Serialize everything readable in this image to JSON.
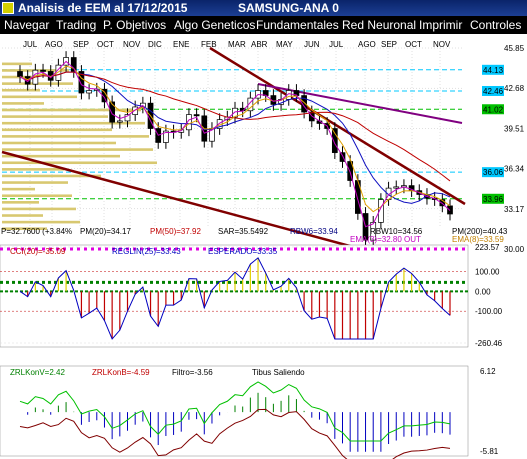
{
  "window": {
    "title": "Analisis de EEM al 17/12/2015",
    "symbol": "SAMSUNG-ANA 0"
  },
  "menu": [
    "Navegar",
    "Trading",
    "P. Objetivos",
    "Algo Geneticos",
    "Fundamentales",
    "Red Neuronal",
    "Imprimir",
    "Controles"
  ],
  "chart_data": {
    "type": "candlestick",
    "months": [
      "JUL",
      "AGO",
      "SEP",
      "OCT",
      "NOV",
      "DIC",
      "ENE",
      "FEB",
      "MAR",
      "ABR",
      "MAY",
      "JUN",
      "JUL",
      "AGO",
      "SEP",
      "OCT",
      "NOV"
    ],
    "price_ticks": [
      "45.85",
      "42.68",
      "39.51",
      "36.34",
      "33.17",
      "30.00"
    ],
    "price_range": [
      30.0,
      45.85
    ],
    "price_boxes": [
      {
        "value": "44.13",
        "color": "#00c8ff"
      },
      {
        "value": "42.46",
        "color": "#00c8ff"
      },
      {
        "value": "41.02",
        "color": "#00c000"
      },
      {
        "value": "36.06",
        "color": "#00c8ff"
      },
      {
        "value": "33.96",
        "color": "#00c000"
      }
    ],
    "info_top": "P=32.7600 (+3.84%",
    "info_labels": [
      "PM(20)=34.17",
      "PM(50)=37.92",
      "SAR=35.5492",
      "RBW6=33.94",
      "RBW10=34.56",
      "PM(200)=40.43"
    ],
    "info_ema3": "EMA(3)=32.80 OUT",
    "info_ema8": "EMA(8)=33.59",
    "osc1_labels": [
      "CCI(20)=-35.09",
      "REGLIN(25)=33.43",
      "ESPERADO=33.35"
    ],
    "osc1_ticks": [
      "223.57",
      "100.00",
      "0.00",
      "-100.00",
      "-260.46"
    ],
    "osc1_range": [
      -260.46,
      223.57
    ],
    "osc2_labels": [
      "ZRLKonV=2.42",
      "ZRLKonB=-4.59",
      "Filtro=-3.56",
      "Tibus Saliendo"
    ],
    "osc2_ticks": [
      "6.12",
      "-5.81"
    ],
    "osc2_range": [
      -5.81,
      6.12
    ],
    "close": [
      43.6,
      43.0,
      44.1,
      44.0,
      43.3,
      44.5,
      45.1,
      44.0,
      42.3,
      42.5,
      42.6,
      41.6,
      40.0,
      40.1,
      40.6,
      41.2,
      41.5,
      39.5,
      38.4,
      39.3,
      39.2,
      39.4,
      40.6,
      40.5,
      38.5,
      39.5,
      40.2,
      40.4,
      41.1,
      40.9,
      41.9,
      42.5,
      42.1,
      41.4,
      41.8,
      42.5,
      42.1,
      40.8,
      40.1,
      39.9,
      39.5,
      37.6,
      36.9,
      35.4,
      32.8,
      30.7,
      32.1,
      33.9,
      34.8,
      34.9,
      35.0,
      34.6,
      34.3,
      34.0,
      33.9,
      33.4,
      32.76
    ]
  }
}
